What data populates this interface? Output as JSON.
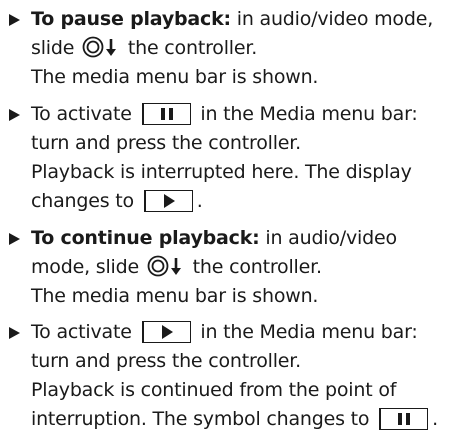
{
  "items": [
    {
      "lead": "To pause playback:",
      "l1_after": " in audio/video mode,",
      "l2_before": "slide ",
      "l2_after": " the controller.",
      "l3": "The media menu bar is shown."
    },
    {
      "l1_before": "To activate ",
      "l1_after": " in the Media menu bar:",
      "l2": "turn and press the controller.",
      "l3": "Playback is interrupted here. The display",
      "l4_before": "changes to ",
      "l4_after": "."
    },
    {
      "lead": "To continue playback:",
      "l1_after": " in audio/video",
      "l2_before": "mode, slide ",
      "l2_after": " the controller.",
      "l3": "The media menu bar is shown."
    },
    {
      "l1_before": "To activate ",
      "l1_after": " in the Media menu bar:",
      "l2": "turn and press the controller.",
      "l3": "Playback is continued from the point of",
      "l4_before": "interruption. The symbol changes to ",
      "l4_after": "."
    }
  ],
  "icons": {
    "bullet": "triangle-bullet-icon",
    "controller": "controller-slide-down-icon",
    "pause": "pause-icon",
    "play": "play-icon"
  },
  "colors": {
    "text": "#1a1a1a",
    "background": "#ffffff"
  }
}
